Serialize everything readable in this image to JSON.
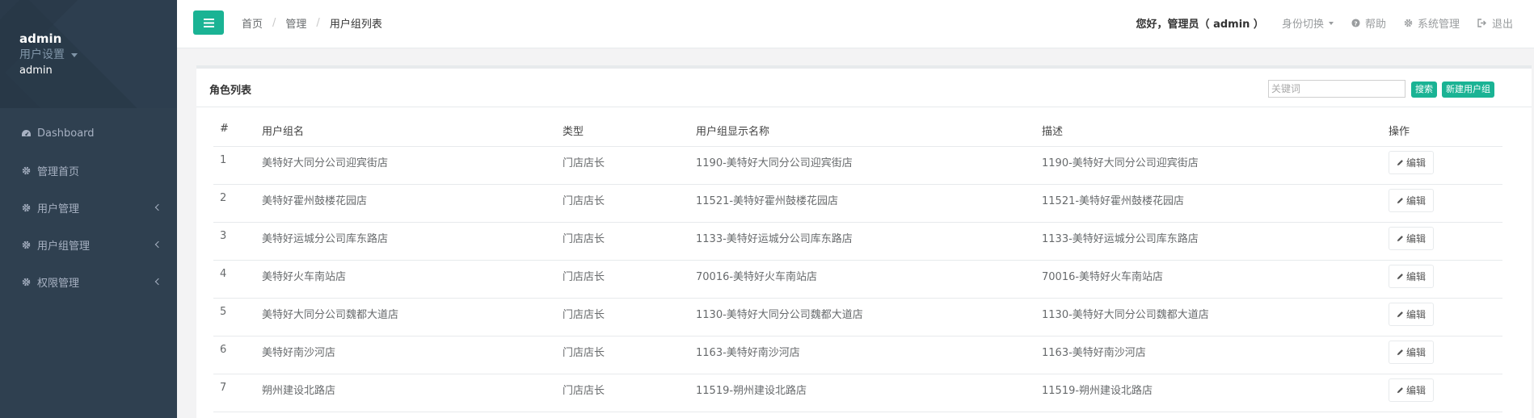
{
  "sidebar": {
    "user_name": "admin",
    "settings_label": "用户设置",
    "role": "admin",
    "items": [
      {
        "label": "Dashboard",
        "icon": "dashboard-icon"
      },
      {
        "label": "管理首页",
        "icon": "gear-icon"
      },
      {
        "label": "用户管理",
        "icon": "gear-icon"
      },
      {
        "label": "用户组管理",
        "icon": "gear-icon"
      },
      {
        "label": "权限管理",
        "icon": "gear-icon"
      }
    ]
  },
  "header": {
    "breadcrumb": [
      "首页",
      "管理",
      "用户组列表"
    ],
    "greeting": "您好，管理员（ admin ）",
    "switch_identity": "身份切换",
    "help": "帮助",
    "system": "系统管理",
    "logout": "退出"
  },
  "panel": {
    "title": "角色列表",
    "search_placeholder": "关键词",
    "search_button": "搜索",
    "new_button": "新建用户组"
  },
  "table": {
    "headers": [
      "#",
      "用户组名",
      "类型",
      "用户组显示名称",
      "描述",
      "操作"
    ],
    "edit_label": "编辑",
    "rows": [
      [
        "1",
        "美特好大同分公司迎宾街店",
        "门店店长",
        "1190-美特好大同分公司迎宾街店",
        "1190-美特好大同分公司迎宾街店"
      ],
      [
        "2",
        "美特好霍州鼓楼花园店",
        "门店店长",
        "11521-美特好霍州鼓楼花园店",
        "11521-美特好霍州鼓楼花园店"
      ],
      [
        "3",
        "美特好运城分公司库东路店",
        "门店店长",
        "1133-美特好运城分公司库东路店",
        "1133-美特好运城分公司库东路店"
      ],
      [
        "4",
        "美特好火车南站店",
        "门店店长",
        "70016-美特好火车南站店",
        "70016-美特好火车南站店"
      ],
      [
        "5",
        "美特好大同分公司魏都大道店",
        "门店店长",
        "1130-美特好大同分公司魏都大道店",
        "1130-美特好大同分公司魏都大道店"
      ],
      [
        "6",
        "美特好南沙河店",
        "门店店长",
        "1163-美特好南沙河店",
        "1163-美特好南沙河店"
      ],
      [
        "7",
        "朔州建设北路店",
        "门店店长",
        "11519-朔州建设北路店",
        "11519-朔州建设北路店"
      ]
    ]
  }
}
